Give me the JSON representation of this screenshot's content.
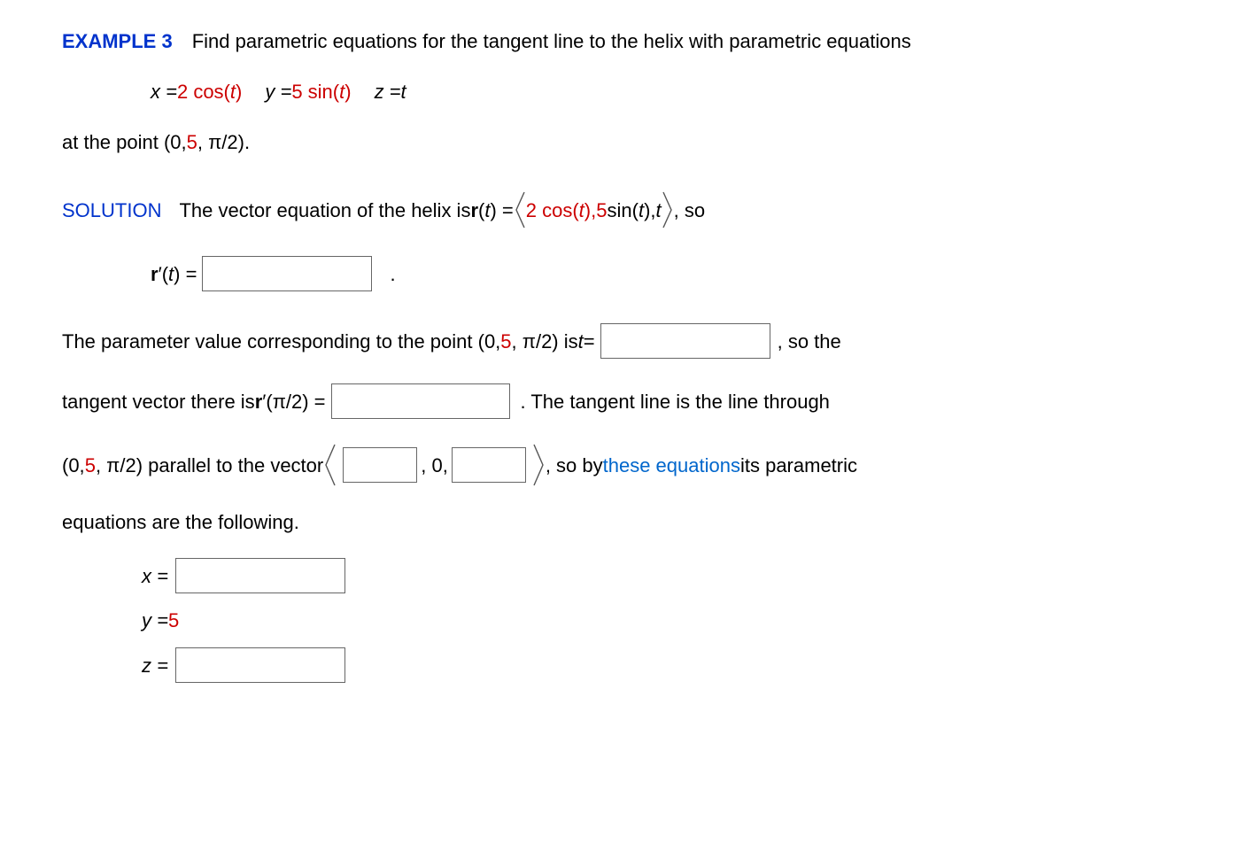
{
  "header": {
    "example_label": "EXAMPLE 3",
    "problem_text": "Find parametric equations for the tangent line to the helix with parametric equations"
  },
  "equations": {
    "x_prefix": "x = ",
    "x_value": "2 cos(",
    "x_var": "t",
    "x_close": ")",
    "y_prefix": "y = ",
    "y_value": "5 sin(",
    "y_var": "t",
    "y_close": ")",
    "z_prefix": "z = ",
    "z_var": "t"
  },
  "at_point": {
    "prefix": "at the point  (0, ",
    "five": "5",
    "suffix": ", π/2)."
  },
  "solution": {
    "label": "SOLUTION",
    "line1_a": "The vector equation of the helix is  ",
    "line1_r": "r",
    "line1_b": "(",
    "line1_t": "t",
    "line1_c": ") = ",
    "vec_a1": "2 cos(",
    "vec_t1": "t",
    "vec_a2": "), ",
    "vec_5": "5",
    "vec_a3": " sin(",
    "vec_t2": "t",
    "vec_a4": "), ",
    "vec_t3": "t",
    "line1_after": ",  so"
  },
  "rprime_line": {
    "r": "r",
    "prime": "′",
    "open": "(",
    "t": "t",
    "close": ") = ",
    "dot": "."
  },
  "param_line": {
    "a": "The parameter value corresponding to the point  (0, ",
    "five": "5",
    "b": ", π/2)  is  ",
    "t": "t",
    "eq": " = ",
    "after": ",  so the"
  },
  "tangent_line": {
    "a": "tangent vector there is  ",
    "r": "r",
    "prime": "′",
    "open": "(",
    "arg": "π/2",
    "close": ") = ",
    "after": ".  The tangent line is the line through"
  },
  "parallel_line": {
    "a1": "(0, ",
    "five": "5",
    "a2": ", π/2)  parallel to the vector  ",
    "comma0": ", 0, ",
    "after1": ",  so by ",
    "link": "these equations",
    "after2": " its parametric"
  },
  "eqs_following": "equations are the following.",
  "answers": {
    "x_label": "x = ",
    "y_label": "y = ",
    "y_value": "5",
    "z_label": "z = "
  }
}
